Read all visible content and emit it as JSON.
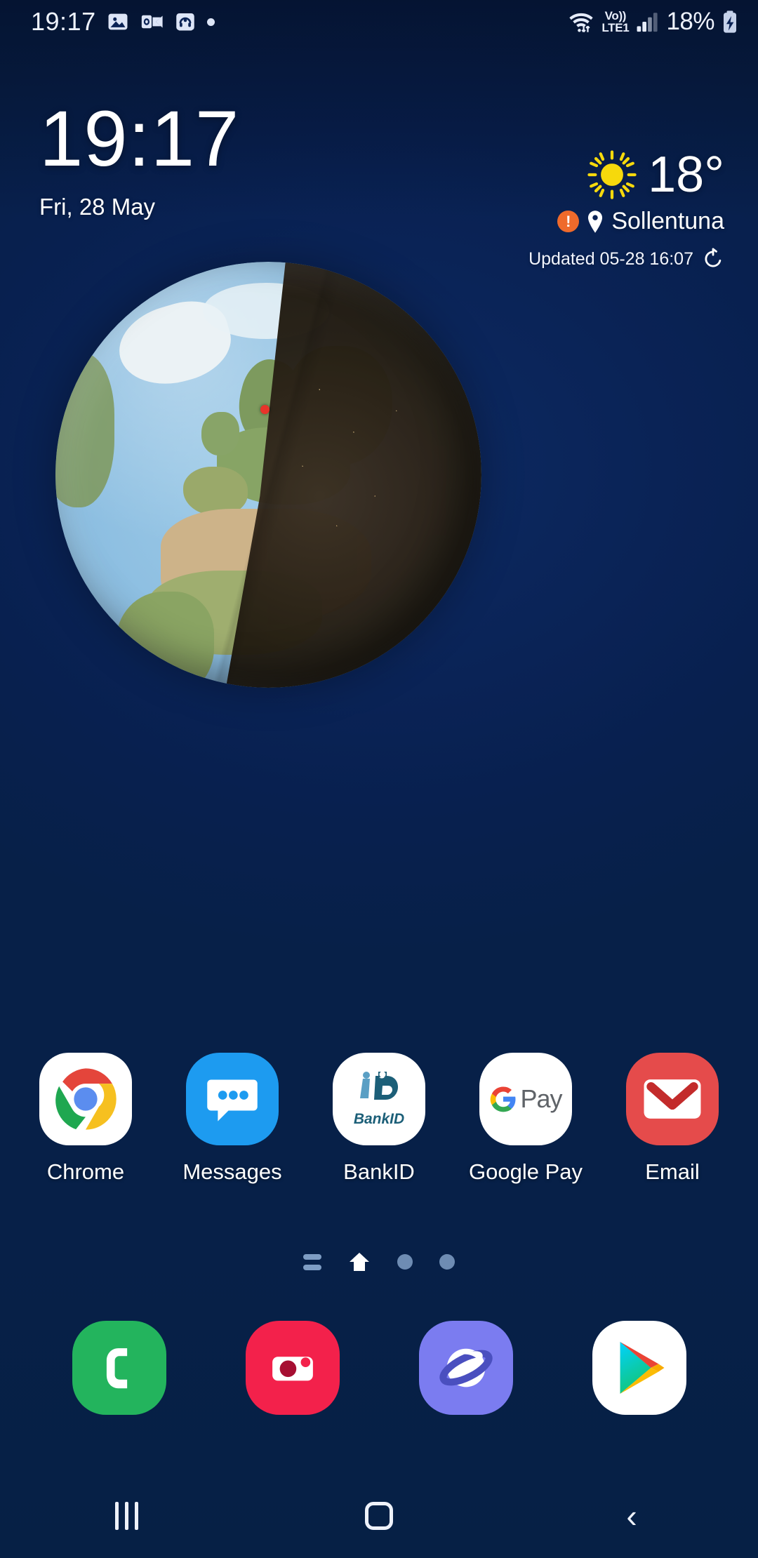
{
  "status_bar": {
    "time": "19:17",
    "icons_left": [
      "gallery-icon",
      "outlook-icon",
      "headphones-icon",
      "dot-indicator-icon"
    ],
    "network": {
      "voice_label": "Vo))",
      "tech_label": "LTE1"
    },
    "battery_percent": "18%",
    "battery_state": "charging"
  },
  "clock_widget": {
    "time": "19:17",
    "date": "Fri, 28 May"
  },
  "weather_widget": {
    "temperature": "18°",
    "condition_icon": "sun-icon",
    "alert_icon": "warning-icon",
    "alert_glyph": "!",
    "location_icon": "location-pin-icon",
    "city": "Sollentuna",
    "updated": "Updated 05-28 16:07",
    "refresh_icon": "refresh-icon",
    "colors": {
      "sun": "#F6D90C",
      "alert": "#EF6A2B"
    }
  },
  "globe_widget": {
    "name": "earth-day-night-widget",
    "marker_label": "current-location-marker",
    "marker_color": "#E8342A"
  },
  "apps": [
    {
      "label": "Chrome",
      "icon": "chrome-icon"
    },
    {
      "label": "Messages",
      "icon": "messages-icon"
    },
    {
      "label": "BankID",
      "icon": "bankid-icon",
      "logo_text": "BankID"
    },
    {
      "label": "Google Pay",
      "icon": "google-pay-icon",
      "logo_text": "Pay"
    },
    {
      "label": "Email",
      "icon": "email-icon"
    }
  ],
  "page_indicators": {
    "items": [
      "app-list-page",
      "home-page",
      "page-3",
      "page-4"
    ],
    "active": "home-page"
  },
  "dock": [
    {
      "label": "Phone",
      "icon": "phone-icon",
      "color": "#23B45D"
    },
    {
      "label": "Camera",
      "icon": "camera-icon",
      "color": "#F3214B"
    },
    {
      "label": "Samsung Internet",
      "icon": "internet-icon",
      "color": "#7B7CF0"
    },
    {
      "label": "Play Store",
      "icon": "play-store-icon",
      "color": "#FFFFFF"
    }
  ],
  "nav_bar": {
    "recents_label": "recents-button",
    "home_label": "home-button",
    "back_label": "back-button",
    "back_glyph": "‹"
  }
}
